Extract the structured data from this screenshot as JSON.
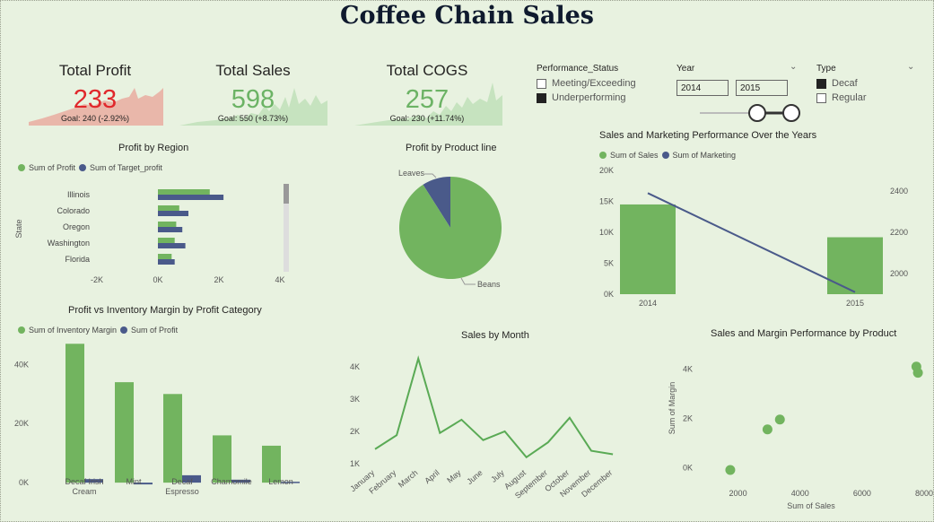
{
  "title": "Coffee Chain Sales",
  "kpis": [
    {
      "title": "Total Profit",
      "value": "233",
      "goal": "Goal: 240 (-2.92%)",
      "color": "#e0282c"
    },
    {
      "title": "Total Sales",
      "value": "598",
      "goal": "Goal: 550 (+8.73%)",
      "color": "#6cb365"
    },
    {
      "title": "Total COGS",
      "value": "257",
      "goal": "Goal: 230 (+11.74%)",
      "color": "#6cb365"
    }
  ],
  "slicers": {
    "performance": {
      "title": "Performance_Status",
      "options": [
        {
          "label": "Meeting/Exceeding",
          "checked": false
        },
        {
          "label": "Underperforming",
          "checked": true
        }
      ]
    },
    "year": {
      "title": "Year",
      "from": "2014",
      "to": "2015"
    },
    "type": {
      "title": "Type",
      "options": [
        {
          "label": "Decaf",
          "checked": true
        },
        {
          "label": "Regular",
          "checked": false
        }
      ]
    }
  },
  "colors": {
    "green": "#72b45f",
    "navy": "#4a5a8a",
    "line": "#5aaa55"
  },
  "chart_data": [
    {
      "id": "profit_by_region",
      "type": "bar",
      "title": "Profit by Region",
      "ylabel": "State",
      "categories": [
        "Illinois",
        "Colorado",
        "Oregon",
        "Washington",
        "Florida"
      ],
      "series": [
        {
          "name": "Sum of Profit",
          "values": [
            1700,
            700,
            600,
            550,
            450
          ]
        },
        {
          "name": "Sum of Target_profit",
          "values": [
            2150,
            1000,
            800,
            900,
            550
          ]
        }
      ],
      "xticks": [
        "-2K",
        "0K",
        "2K",
        "4K"
      ],
      "xlim": [
        -2000,
        4000
      ]
    },
    {
      "id": "profit_by_product_line",
      "type": "pie",
      "title": "Profit by Product line",
      "labels": [
        "Leaves",
        "Beans"
      ],
      "values": [
        9,
        91
      ]
    },
    {
      "id": "sales_marketing",
      "type": "bar",
      "title": "Sales and Marketing Performance Over the Years",
      "categories": [
        "2014",
        "2015"
      ],
      "series": [
        {
          "name": "Sum of Sales",
          "values": [
            14500,
            9200
          ]
        },
        {
          "name": "Sum of Marketing",
          "values": [
            2390,
            1910
          ]
        }
      ],
      "yticks": [
        "0K",
        "5K",
        "10K",
        "15K",
        "20K"
      ],
      "ylim": [
        0,
        20000
      ],
      "y2ticks": [
        "2000",
        "2200",
        "2400"
      ],
      "y2lim": [
        1900,
        2500
      ]
    },
    {
      "id": "profit_vs_inventory",
      "type": "bar",
      "title": "Profit vs Inventory Margin by Profit Category",
      "categories": [
        "Decaf Irish Cream",
        "Mint",
        "Decaf Espresso",
        "Chamomile",
        "Lemon"
      ],
      "series": [
        {
          "name": "Sum of Inventory Margin",
          "values": [
            47000,
            34000,
            30000,
            16000,
            12500
          ]
        },
        {
          "name": "Sum of Profit",
          "values": [
            1200,
            -600,
            2500,
            1000,
            300
          ]
        }
      ],
      "yticks": [
        "0K",
        "20K",
        "40K"
      ],
      "ylim": [
        -3000,
        48000
      ]
    },
    {
      "id": "sales_by_month",
      "type": "line",
      "title": "Sales by Month",
      "x": [
        "January",
        "February",
        "March",
        "April",
        "May",
        "June",
        "July",
        "August",
        "September",
        "October",
        "November",
        "December"
      ],
      "values": [
        1450,
        1880,
        4250,
        1950,
        2360,
        1730,
        2000,
        1200,
        1660,
        2420,
        1400,
        1290
      ],
      "yticks": [
        "1K",
        "2K",
        "3K",
        "4K"
      ],
      "ylim": [
        1000,
        4300
      ]
    },
    {
      "id": "sales_margin_by_product",
      "type": "scatter",
      "title": "Sales and Margin Performance by Product",
      "xlabel": "Sum of Sales",
      "ylabel": "Sum of Margin",
      "points": [
        {
          "x": 1750,
          "y": -100
        },
        {
          "x": 2950,
          "y": 1550
        },
        {
          "x": 3350,
          "y": 1950
        },
        {
          "x": 7750,
          "y": 4100
        },
        {
          "x": 7800,
          "y": 3850
        }
      ],
      "xticks": [
        "2000",
        "4000",
        "6000",
        "8000"
      ],
      "xlim": [
        1000,
        8000
      ],
      "yticks": [
        "0K",
        "2K",
        "4K"
      ],
      "ylim": [
        -500,
        4600
      ]
    }
  ]
}
